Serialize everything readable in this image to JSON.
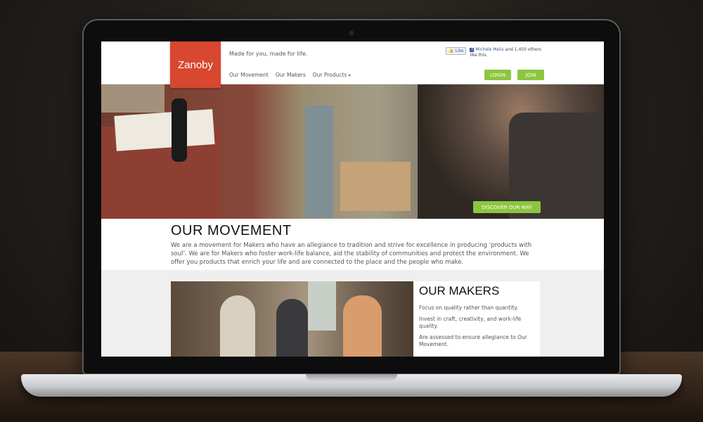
{
  "site": {
    "logo": "Zanoby",
    "tagline": "Made for you, made for life.",
    "nav": [
      "Our Movement",
      "Our Makers",
      "Our Products"
    ],
    "facebook": {
      "like_label": "Like",
      "name": "Michele Melis",
      "text": "and 1,450 others like this."
    },
    "login_label": "LOGIN",
    "join_label": "JOIN"
  },
  "hero": {
    "cta_label": "DISCOVER OUR WAY"
  },
  "movement": {
    "title": "OUR MOVEMENT",
    "text": "We are a movement for Makers who have an allegiance to tradition and strive for excellence in producing ‘products with soul’. We are for Makers who foster work-life balance, aid the stability of communities and protect the environment. We offer you products that enrich your life and are connected to the place and the people who make."
  },
  "makers": {
    "title": "OUR MAKERS",
    "points": [
      "Focus on quality rather than quantity.",
      "Invest in craft, creativity, and work-life quality.",
      "Are assessed to ensure allegiance to Our Movement."
    ]
  },
  "colors": {
    "brand": "#d8472f",
    "accent": "#8cc63f",
    "facebook": "#3b5998"
  }
}
